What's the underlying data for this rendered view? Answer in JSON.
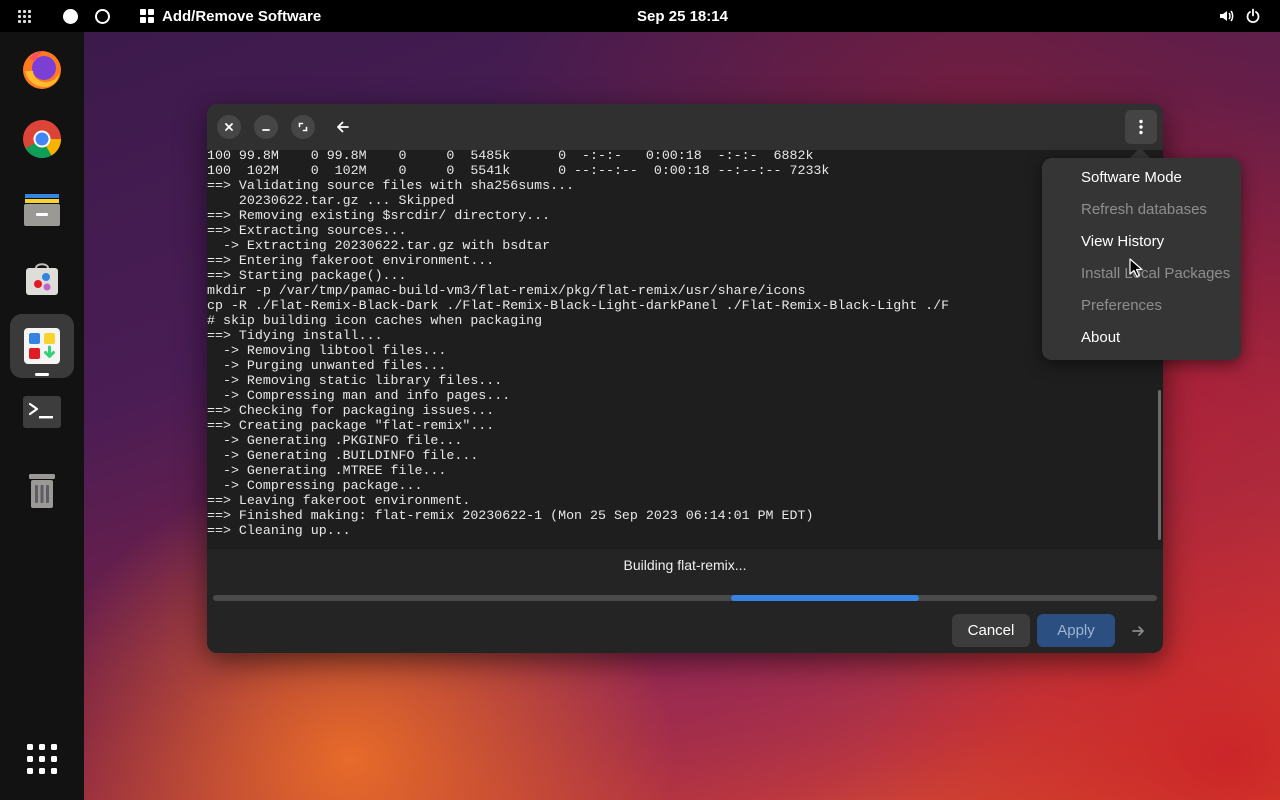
{
  "topbar": {
    "app_name": "Add/Remove Software",
    "clock": "Sep 25  18:14",
    "icons": [
      "apps-grid-icon",
      "workspace-1-icon",
      "workspace-2-icon",
      "volume-icon",
      "power-icon"
    ]
  },
  "dock": {
    "items": [
      "firefox",
      "chrome",
      "file-manager",
      "software-store",
      "add-remove-software",
      "terminal",
      "trash",
      "show-applications"
    ],
    "active": "add-remove-software"
  },
  "window": {
    "terminal_lines": [
      "100 99.8M    0 99.8M    0     0  5485k      0  -:-:-   0:00:18  -:-:-  6882k",
      "100  102M    0  102M    0     0  5541k      0 --:--:--  0:00:18 --:--:-- 7233k",
      "==> Validating source files with sha256sums...",
      "    20230622.tar.gz ... Skipped",
      "==> Removing existing $srcdir/ directory...",
      "==> Extracting sources...",
      "  -> Extracting 20230622.tar.gz with bsdtar",
      "==> Entering fakeroot environment...",
      "==> Starting package()...",
      "mkdir -p /var/tmp/pamac-build-vm3/flat-remix/pkg/flat-remix/usr/share/icons",
      "cp -R ./Flat-Remix-Black-Dark ./Flat-Remix-Black-Light-darkPanel ./Flat-Remix-Black-Light ./F",
      "# skip building icon caches when packaging",
      "==> Tidying install...",
      "  -> Removing libtool files...",
      "  -> Purging unwanted files...",
      "  -> Removing static library files...",
      "  -> Compressing man and info pages...",
      "==> Checking for packaging issues...",
      "==> Creating package \"flat-remix\"...",
      "  -> Generating .PKGINFO file...",
      "  -> Generating .BUILDINFO file...",
      "  -> Generating .MTREE file...",
      "  -> Compressing package...",
      "==> Leaving fakeroot environment.",
      "==> Finished making: flat-remix 20230622-1 (Mon 25 Sep 2023 06:14:01 PM EDT)",
      "==> Cleaning up..."
    ],
    "status": "Building flat-remix...",
    "progress": {
      "start_fraction": 0.549,
      "end_fraction": 0.748,
      "color": "#3584e4"
    },
    "cancel_label": "Cancel",
    "apply_label": "Apply"
  },
  "menu": {
    "items": [
      {
        "label": "Software Mode",
        "enabled": true
      },
      {
        "label": "Refresh databases",
        "enabled": false
      },
      {
        "label": "View History",
        "enabled": true
      },
      {
        "label": "Install Local Packages",
        "enabled": false
      },
      {
        "label": "Preferences",
        "enabled": false
      },
      {
        "label": "About",
        "enabled": true
      }
    ]
  }
}
